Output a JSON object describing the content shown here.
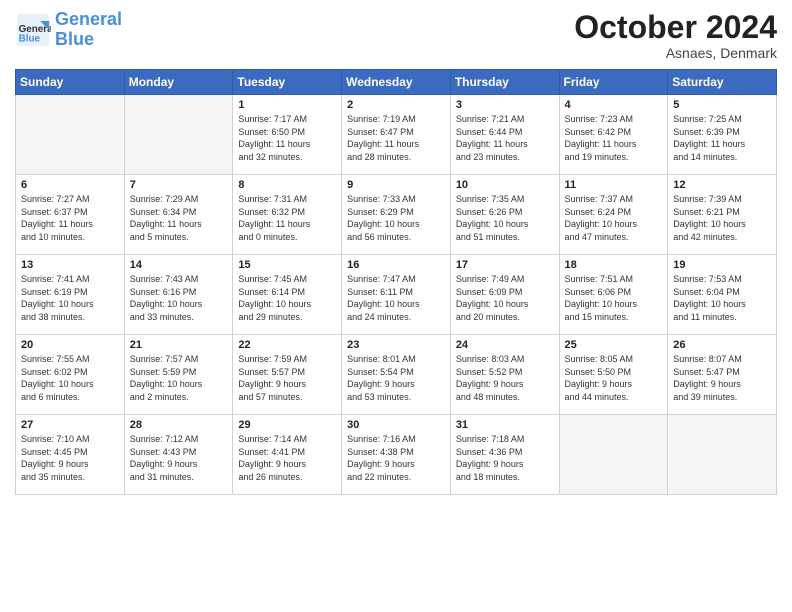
{
  "logo": {
    "line1": "General",
    "line2": "Blue"
  },
  "title": {
    "month": "October 2024",
    "location": "Asnaes, Denmark"
  },
  "days_header": [
    "Sunday",
    "Monday",
    "Tuesday",
    "Wednesday",
    "Thursday",
    "Friday",
    "Saturday"
  ],
  "weeks": [
    [
      {
        "num": "",
        "info": ""
      },
      {
        "num": "",
        "info": ""
      },
      {
        "num": "1",
        "info": "Sunrise: 7:17 AM\nSunset: 6:50 PM\nDaylight: 11 hours\nand 32 minutes."
      },
      {
        "num": "2",
        "info": "Sunrise: 7:19 AM\nSunset: 6:47 PM\nDaylight: 11 hours\nand 28 minutes."
      },
      {
        "num": "3",
        "info": "Sunrise: 7:21 AM\nSunset: 6:44 PM\nDaylight: 11 hours\nand 23 minutes."
      },
      {
        "num": "4",
        "info": "Sunrise: 7:23 AM\nSunset: 6:42 PM\nDaylight: 11 hours\nand 19 minutes."
      },
      {
        "num": "5",
        "info": "Sunrise: 7:25 AM\nSunset: 6:39 PM\nDaylight: 11 hours\nand 14 minutes."
      }
    ],
    [
      {
        "num": "6",
        "info": "Sunrise: 7:27 AM\nSunset: 6:37 PM\nDaylight: 11 hours\nand 10 minutes."
      },
      {
        "num": "7",
        "info": "Sunrise: 7:29 AM\nSunset: 6:34 PM\nDaylight: 11 hours\nand 5 minutes."
      },
      {
        "num": "8",
        "info": "Sunrise: 7:31 AM\nSunset: 6:32 PM\nDaylight: 11 hours\nand 0 minutes."
      },
      {
        "num": "9",
        "info": "Sunrise: 7:33 AM\nSunset: 6:29 PM\nDaylight: 10 hours\nand 56 minutes."
      },
      {
        "num": "10",
        "info": "Sunrise: 7:35 AM\nSunset: 6:26 PM\nDaylight: 10 hours\nand 51 minutes."
      },
      {
        "num": "11",
        "info": "Sunrise: 7:37 AM\nSunset: 6:24 PM\nDaylight: 10 hours\nand 47 minutes."
      },
      {
        "num": "12",
        "info": "Sunrise: 7:39 AM\nSunset: 6:21 PM\nDaylight: 10 hours\nand 42 minutes."
      }
    ],
    [
      {
        "num": "13",
        "info": "Sunrise: 7:41 AM\nSunset: 6:19 PM\nDaylight: 10 hours\nand 38 minutes."
      },
      {
        "num": "14",
        "info": "Sunrise: 7:43 AM\nSunset: 6:16 PM\nDaylight: 10 hours\nand 33 minutes."
      },
      {
        "num": "15",
        "info": "Sunrise: 7:45 AM\nSunset: 6:14 PM\nDaylight: 10 hours\nand 29 minutes."
      },
      {
        "num": "16",
        "info": "Sunrise: 7:47 AM\nSunset: 6:11 PM\nDaylight: 10 hours\nand 24 minutes."
      },
      {
        "num": "17",
        "info": "Sunrise: 7:49 AM\nSunset: 6:09 PM\nDaylight: 10 hours\nand 20 minutes."
      },
      {
        "num": "18",
        "info": "Sunrise: 7:51 AM\nSunset: 6:06 PM\nDaylight: 10 hours\nand 15 minutes."
      },
      {
        "num": "19",
        "info": "Sunrise: 7:53 AM\nSunset: 6:04 PM\nDaylight: 10 hours\nand 11 minutes."
      }
    ],
    [
      {
        "num": "20",
        "info": "Sunrise: 7:55 AM\nSunset: 6:02 PM\nDaylight: 10 hours\nand 6 minutes."
      },
      {
        "num": "21",
        "info": "Sunrise: 7:57 AM\nSunset: 5:59 PM\nDaylight: 10 hours\nand 2 minutes."
      },
      {
        "num": "22",
        "info": "Sunrise: 7:59 AM\nSunset: 5:57 PM\nDaylight: 9 hours\nand 57 minutes."
      },
      {
        "num": "23",
        "info": "Sunrise: 8:01 AM\nSunset: 5:54 PM\nDaylight: 9 hours\nand 53 minutes."
      },
      {
        "num": "24",
        "info": "Sunrise: 8:03 AM\nSunset: 5:52 PM\nDaylight: 9 hours\nand 48 minutes."
      },
      {
        "num": "25",
        "info": "Sunrise: 8:05 AM\nSunset: 5:50 PM\nDaylight: 9 hours\nand 44 minutes."
      },
      {
        "num": "26",
        "info": "Sunrise: 8:07 AM\nSunset: 5:47 PM\nDaylight: 9 hours\nand 39 minutes."
      }
    ],
    [
      {
        "num": "27",
        "info": "Sunrise: 7:10 AM\nSunset: 4:45 PM\nDaylight: 9 hours\nand 35 minutes."
      },
      {
        "num": "28",
        "info": "Sunrise: 7:12 AM\nSunset: 4:43 PM\nDaylight: 9 hours\nand 31 minutes."
      },
      {
        "num": "29",
        "info": "Sunrise: 7:14 AM\nSunset: 4:41 PM\nDaylight: 9 hours\nand 26 minutes."
      },
      {
        "num": "30",
        "info": "Sunrise: 7:16 AM\nSunset: 4:38 PM\nDaylight: 9 hours\nand 22 minutes."
      },
      {
        "num": "31",
        "info": "Sunrise: 7:18 AM\nSunset: 4:36 PM\nDaylight: 9 hours\nand 18 minutes."
      },
      {
        "num": "",
        "info": ""
      },
      {
        "num": "",
        "info": ""
      }
    ]
  ]
}
